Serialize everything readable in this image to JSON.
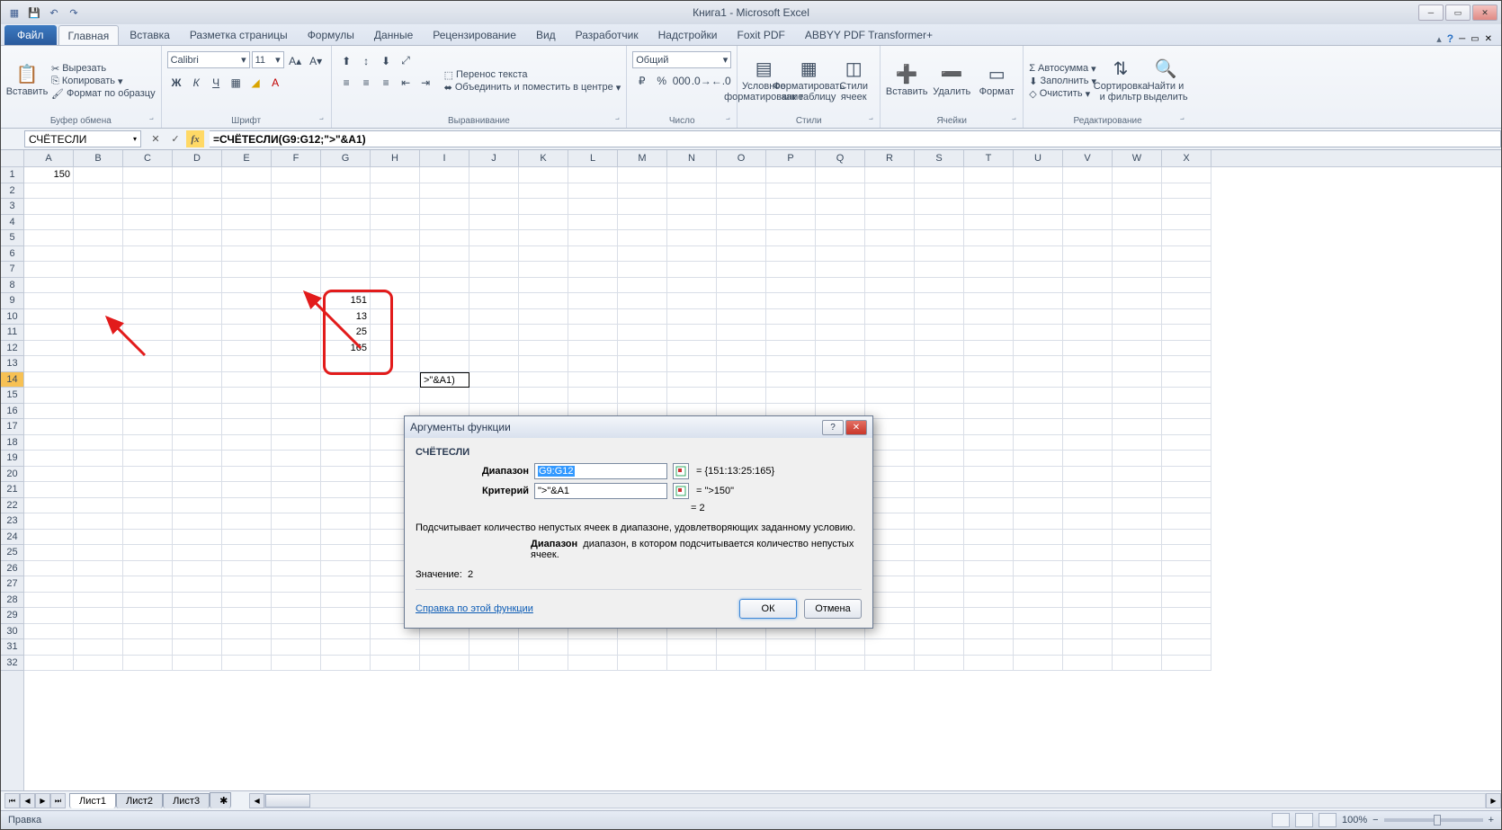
{
  "title": "Книга1 - Microsoft Excel",
  "tabs": {
    "file": "Файл",
    "items": [
      "Главная",
      "Вставка",
      "Разметка страницы",
      "Формулы",
      "Данные",
      "Рецензирование",
      "Вид",
      "Разработчик",
      "Надстройки",
      "Foxit PDF",
      "ABBYY PDF Transformer+"
    ]
  },
  "ribbon": {
    "clipboard": {
      "paste": "Вставить",
      "cut": "Вырезать",
      "copy": "Копировать",
      "format": "Формат по образцу",
      "label": "Буфер обмена"
    },
    "font": {
      "name": "Calibri",
      "size": "11",
      "label": "Шрифт"
    },
    "align": {
      "wrap": "Перенос текста",
      "merge": "Объединить и поместить в центре",
      "label": "Выравнивание"
    },
    "number": {
      "fmt": "Общий",
      "label": "Число"
    },
    "styles": {
      "cond": "Условное форматирование",
      "table": "Форматировать как таблицу",
      "cell": "Стили ячеек",
      "label": "Стили"
    },
    "cells": {
      "insert": "Вставить",
      "delete": "Удалить",
      "format": "Формат",
      "label": "Ячейки"
    },
    "edit": {
      "sum": "Автосумма",
      "fill": "Заполнить",
      "clear": "Очистить",
      "sort": "Сортировка и фильтр",
      "find": "Найти и выделить",
      "label": "Редактирование"
    }
  },
  "namebox": "СЧЁТЕСЛИ",
  "formula": "=СЧЁТЕСЛИ(G9:G12;\">\"&A1)",
  "columns": [
    "A",
    "B",
    "C",
    "D",
    "E",
    "F",
    "G",
    "H",
    "I",
    "J",
    "K",
    "L",
    "M",
    "N",
    "O",
    "P",
    "Q",
    "R",
    "S",
    "T",
    "U",
    "V",
    "W",
    "X"
  ],
  "cells": {
    "A1": "150",
    "G9": "151",
    "G10": "13",
    "G11": "25",
    "G12": "165",
    "I14": ">\"&A1)"
  },
  "dialog": {
    "title": "Аргументы функции",
    "fn": "СЧЁТЕСЛИ",
    "range_label": "Диапазон",
    "range_val": "G9:G12",
    "range_res": "{151:13:25:165}",
    "crit_label": "Критерий",
    "crit_val": "\">\"&A1",
    "crit_res": "\">150\"",
    "result_eq": "=  2",
    "desc": "Подсчитывает количество непустых ячеек в диапазоне, удовлетворяющих заданному условию.",
    "hint_label": "Диапазон",
    "hint_text": "диапазон, в котором подсчитывается количество непустых ячеек.",
    "value_label": "Значение:",
    "value": "2",
    "help": "Справка по этой функции",
    "ok": "ОК",
    "cancel": "Отмена"
  },
  "sheets": [
    "Лист1",
    "Лист2",
    "Лист3"
  ],
  "status": {
    "mode": "Правка",
    "zoom": "100%"
  }
}
